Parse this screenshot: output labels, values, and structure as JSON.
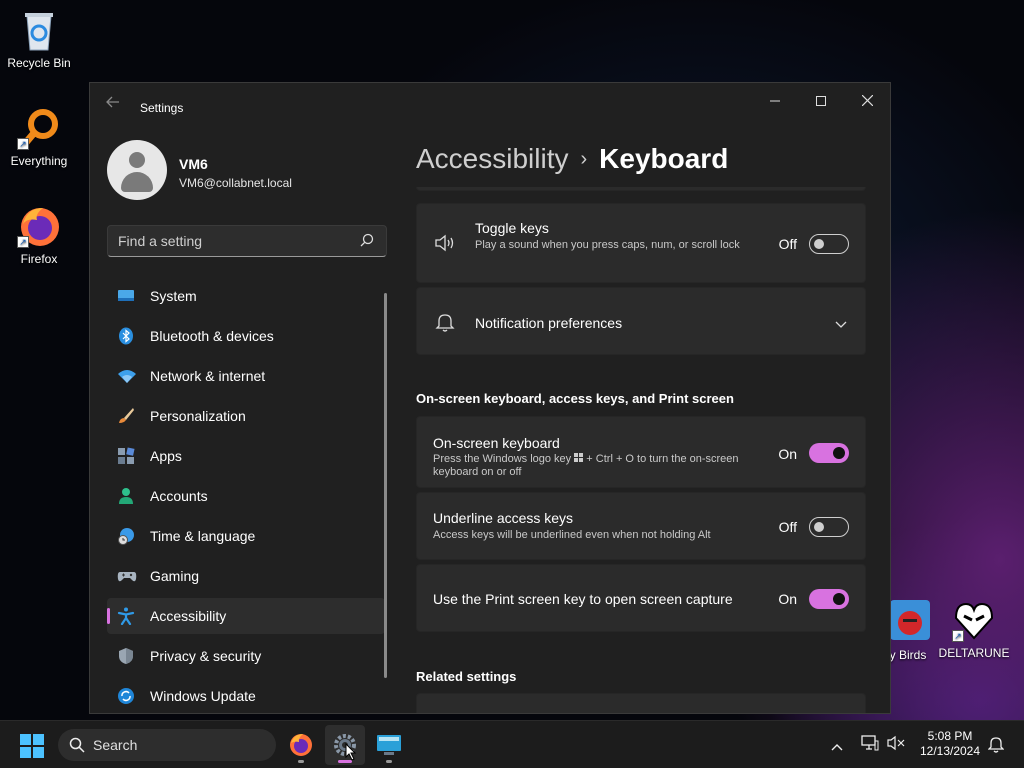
{
  "desktop": {
    "icons": [
      {
        "label": "Recycle Bin"
      },
      {
        "label": "Everything"
      },
      {
        "label": "Firefox"
      },
      {
        "label": "ry Birds"
      },
      {
        "label": "DELTARUNE"
      }
    ]
  },
  "window": {
    "app_title": "Settings",
    "back_icon": "arrow-left-icon",
    "controls": {
      "minimize": "─",
      "maximize": "☐",
      "close": "✕"
    }
  },
  "profile": {
    "name": "VM6",
    "email": "VM6@collabnet.local"
  },
  "search": {
    "placeholder": "Find a setting"
  },
  "nav": {
    "items": [
      {
        "label": "System",
        "icon": "display-icon"
      },
      {
        "label": "Bluetooth & devices",
        "icon": "bluetooth-icon"
      },
      {
        "label": "Network & internet",
        "icon": "wifi-icon"
      },
      {
        "label": "Personalization",
        "icon": "brush-icon"
      },
      {
        "label": "Apps",
        "icon": "apps-icon"
      },
      {
        "label": "Accounts",
        "icon": "person-icon"
      },
      {
        "label": "Time & language",
        "icon": "globe-clock-icon"
      },
      {
        "label": "Gaming",
        "icon": "gamepad-icon"
      },
      {
        "label": "Accessibility",
        "icon": "accessibility-icon",
        "active": true
      },
      {
        "label": "Privacy & security",
        "icon": "shield-icon"
      },
      {
        "label": "Windows Update",
        "icon": "update-icon"
      }
    ],
    "accent": "#d872e0"
  },
  "breadcrumb": {
    "parent": "Accessibility",
    "separator": "›",
    "current": "Keyboard"
  },
  "content": {
    "toggle_keys": {
      "title": "Toggle keys",
      "description": "Play a sound when you press caps, num, or scroll lock",
      "state": "Off"
    },
    "notification_preferences": {
      "title": "Notification preferences"
    },
    "section_onscreen": "On-screen keyboard, access keys, and Print screen",
    "onscreen_keyboard": {
      "title": "On-screen keyboard",
      "description_a": "Press the Windows logo key",
      "description_b": "+ Ctrl + O to turn the on-screen keyboard on or off",
      "state": "On"
    },
    "underline_access_keys": {
      "title": "Underline access keys",
      "description": "Access keys will be underlined even when not holding Alt",
      "state": "Off"
    },
    "print_screen": {
      "title": "Use the Print screen key to open screen capture",
      "state": "On"
    },
    "section_related": "Related settings"
  },
  "taskbar": {
    "search_label": "Search",
    "apps": [
      "start-icon",
      "firefox-icon",
      "settings-icon",
      "remote-desktop-icon"
    ],
    "tray": {
      "time": "5:08 PM",
      "date": "12/13/2024"
    }
  }
}
